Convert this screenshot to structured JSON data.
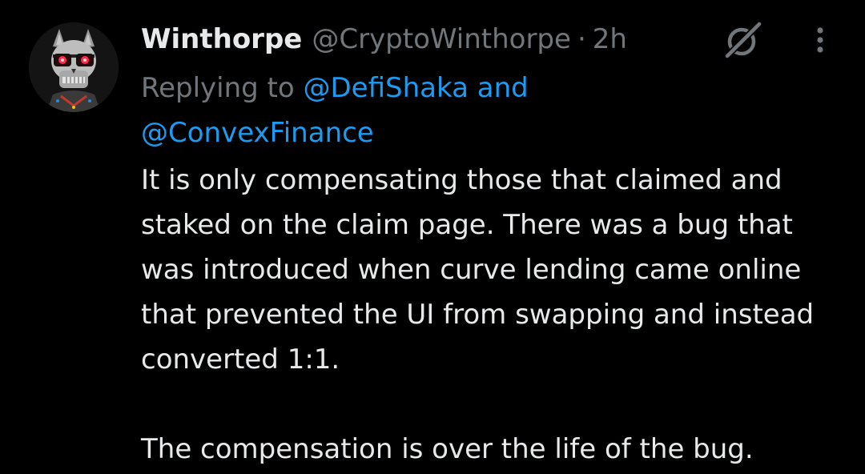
{
  "tweet": {
    "display_name": "Winthorpe",
    "handle": "@CryptoWinthorpe",
    "separator": "·",
    "time": "2h",
    "reply": {
      "prefix": "Replying to ",
      "mention_1": "@DefiShaka",
      "conjunction": " and",
      "mention_2": "@ConvexFinance"
    },
    "body": [
      "It is only compensating those that claimed and staked on the claim page. There was a bug that was introduced when curve lending came online that prevented the UI from swapping and instead converted 1:1.",
      "The compensation is over the life of the bug."
    ]
  },
  "icons": {
    "avatar": "skull-avatar",
    "grok": "grok-icon",
    "more": "more-icon"
  },
  "colors": {
    "background": "#000000",
    "text": "#e7e9ea",
    "secondary": "#71767b",
    "link": "#1d9bf0"
  }
}
